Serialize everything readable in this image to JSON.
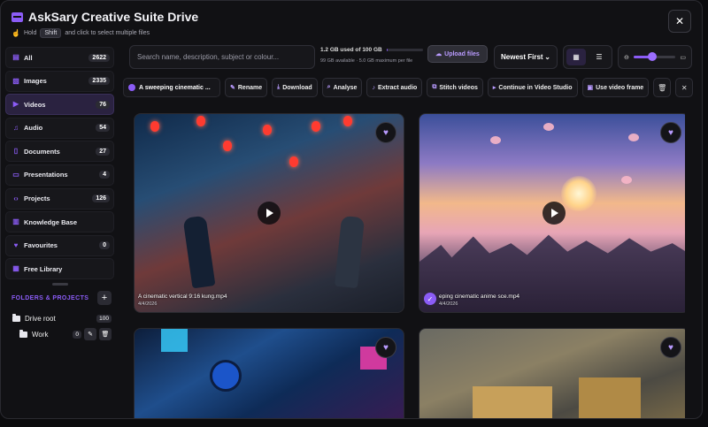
{
  "app": {
    "title": "AskSary Creative Suite Drive",
    "hint_hold": "Hold",
    "hint_key": "Shift",
    "hint_rest": "and click to select multiple files",
    "close_label": "✕"
  },
  "sidebar": {
    "items": [
      {
        "label": "All",
        "count": "2622",
        "icon": "drive-icon"
      },
      {
        "label": "Images",
        "count": "2335",
        "icon": "image-icon"
      },
      {
        "label": "Videos",
        "count": "76",
        "icon": "video-icon"
      },
      {
        "label": "Audio",
        "count": "54",
        "icon": "headphones-icon"
      },
      {
        "label": "Documents",
        "count": "27",
        "icon": "document-icon"
      },
      {
        "label": "Presentations",
        "count": "4",
        "icon": "presentation-icon"
      },
      {
        "label": "Projects",
        "count": "126",
        "icon": "code-icon"
      },
      {
        "label": "Knowledge Base",
        "icon": "database-icon"
      },
      {
        "label": "Favourites",
        "count": "0",
        "icon": "heart-icon"
      },
      {
        "label": "Free Library",
        "icon": "library-icon"
      }
    ],
    "active_index": 2,
    "folders_title": "FOLDERS & PROJECTS",
    "add_label": "+",
    "drive_root": {
      "label": "Drive root",
      "count": "100"
    },
    "subfolder": {
      "label": "Work",
      "count": "0"
    }
  },
  "toolbar": {
    "search_placeholder": "Search name, description, subject or colour...",
    "storage_used": "1.2 GB used of 100 GB",
    "storage_fraction": 0.012,
    "storage_sub": "99 GB available · 5.0 GB maximum per file",
    "upload_label": "Upload files",
    "sort_value": "Newest First",
    "zoom_fraction": 0.45
  },
  "action_bar": {
    "selected_name": "A sweeping cinematic ...",
    "actions": [
      {
        "label": "Rename",
        "icon": "pencil-icon",
        "glyph": "✎"
      },
      {
        "label": "Download",
        "icon": "download-icon",
        "glyph": "⤓"
      },
      {
        "label": "Analyse",
        "icon": "magnifier-icon",
        "glyph": "⌕"
      },
      {
        "label": "Extract audio",
        "icon": "audio-extract-icon",
        "glyph": "♪"
      },
      {
        "label": "Stitch videos",
        "icon": "stitch-icon",
        "glyph": "⧉"
      },
      {
        "label": "Continue in Video Studio",
        "icon": "video-studio-icon",
        "glyph": "▸"
      },
      {
        "label": "Use video frame",
        "icon": "frame-icon",
        "glyph": "▣"
      }
    ]
  },
  "cards": [
    {
      "name": "A cinematic vertical 9:16 kung.mp4",
      "date": "4/4/2026",
      "selected": false
    },
    {
      "name": "eping cinematic anime sce.mp4",
      "date": "4/4/2026",
      "selected": true
    },
    {
      "name": "",
      "date": "",
      "selected": false
    },
    {
      "name": "",
      "date": "",
      "selected": false
    }
  ],
  "colors": {
    "accent": "#8b5cf6",
    "background": "#111114"
  }
}
